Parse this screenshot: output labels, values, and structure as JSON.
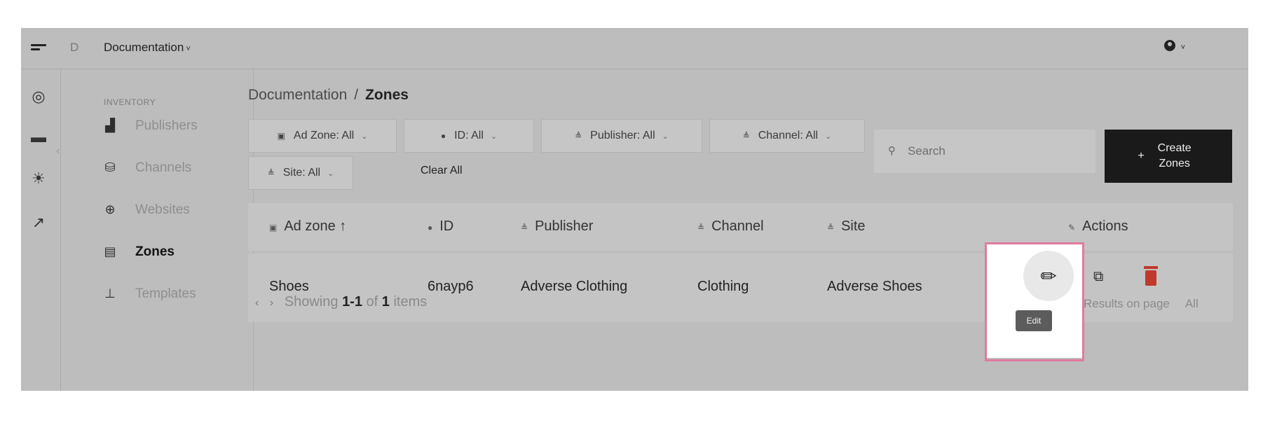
{
  "topbar": {
    "org_initial": "D",
    "org_name": "Documentation",
    "org_chevron": "˅",
    "user_chevron": "˅"
  },
  "rail": [
    {
      "icon": "logo-ring-icon",
      "glyph": "◎"
    },
    {
      "icon": "inventory-box-icon",
      "glyph": "▬"
    },
    {
      "icon": "lightbulb-icon",
      "glyph": "☀"
    },
    {
      "icon": "analytics-chart-icon",
      "glyph": "↗"
    }
  ],
  "sidebar": {
    "section": "INVENTORY",
    "items": [
      {
        "label": "Publishers",
        "icon": "publishers-icon",
        "glyph": "▟"
      },
      {
        "label": "Channels",
        "icon": "channels-icon",
        "glyph": "⛁"
      },
      {
        "label": "Websites",
        "icon": "globe-icon",
        "glyph": "⊕"
      },
      {
        "label": "Zones",
        "icon": "zones-icon",
        "glyph": "▤"
      },
      {
        "label": "Templates",
        "icon": "template-brush-icon",
        "glyph": "⊥"
      }
    ]
  },
  "breadcrumb": {
    "parent": "Documentation",
    "separator": "/",
    "current": "Zones"
  },
  "filters": {
    "ad_zone": "Ad Zone: All",
    "id": "ID: All",
    "publisher": "Publisher: All",
    "channel": "Channel: All",
    "site": "Site: All",
    "clear_all": "Clear All",
    "chevron": "⌄"
  },
  "search": {
    "placeholder": "Search"
  },
  "create_button": {
    "plus": "+",
    "label": "Create Zones"
  },
  "table": {
    "headers": {
      "ad_zone": "Ad zone ↑",
      "id": "ID",
      "publisher": "Publisher",
      "channel": "Channel",
      "site": "Site",
      "actions": "Actions"
    },
    "rows": [
      {
        "ad_zone": "Shoes",
        "id": "6nayp6",
        "publisher": "Adverse Clothing",
        "channel": "Clothing",
        "site": "Adverse Shoes"
      }
    ]
  },
  "tooltip": "Edit",
  "pager": {
    "prev": "‹",
    "next": "›",
    "showing": "Showing",
    "range": "1-1",
    "of": "of",
    "total": "1",
    "items": "items"
  },
  "results": {
    "label": "Results on page",
    "value": "All"
  },
  "colors": {
    "overlay": "#bdbdbd",
    "highlight": "#e07aa0",
    "danger": "#c0392b",
    "primary_button": "#1a1a1a"
  }
}
